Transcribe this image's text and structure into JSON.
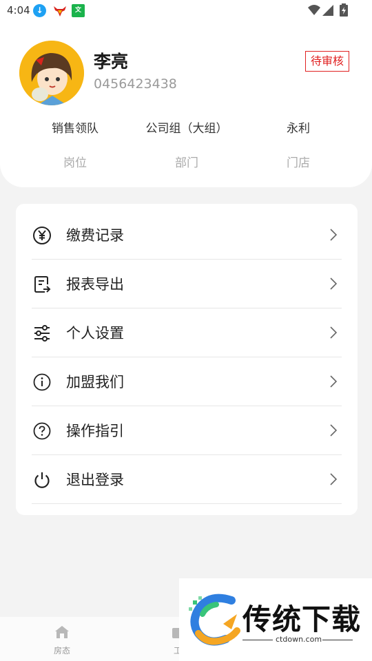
{
  "status_bar": {
    "time": "4:04",
    "icons": [
      "download-icon",
      "bull-app-icon",
      "green-app-icon",
      "wifi-icon",
      "signal-icon",
      "battery-icon"
    ]
  },
  "profile": {
    "name": "李亮",
    "phone": "0456423438",
    "status_badge": "待审核",
    "info": [
      {
        "value": "销售领队",
        "label": "岗位"
      },
      {
        "value": "公司组（大组）",
        "label": "部门"
      },
      {
        "value": "永利",
        "label": "门店"
      }
    ]
  },
  "menu": [
    {
      "label": "缴费记录",
      "icon": "yen-icon"
    },
    {
      "label": "报表导出",
      "icon": "report-export-icon"
    },
    {
      "label": "个人设置",
      "icon": "sliders-icon"
    },
    {
      "label": "加盟我们",
      "icon": "info-icon"
    },
    {
      "label": "操作指引",
      "icon": "help-icon"
    },
    {
      "label": "退出登录",
      "icon": "power-icon"
    }
  ],
  "bottom_nav": [
    {
      "label": "房态",
      "icon": "home-icon"
    },
    {
      "label": "工",
      "icon": "work-icon"
    }
  ],
  "watermark": {
    "title": "传统下载",
    "url": "ctdown.com"
  },
  "colors": {
    "badge": "#e02020",
    "avatar_bg": "#f7b614",
    "page_bg": "#f3f3f3"
  }
}
